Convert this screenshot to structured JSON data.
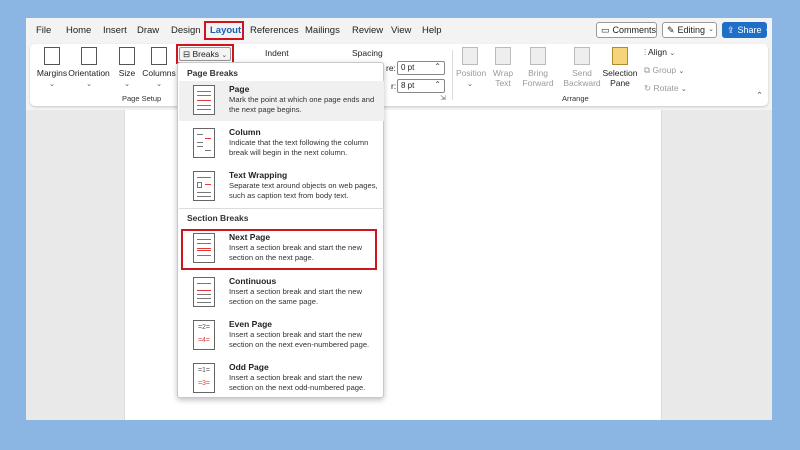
{
  "tabs": [
    "File",
    "Home",
    "Insert",
    "Draw",
    "Design",
    "Layout",
    "References",
    "Mailings",
    "Review",
    "View",
    "Help"
  ],
  "top_buttons": {
    "comments": "Comments",
    "editing": "Editing",
    "share": "Share"
  },
  "ribbon": {
    "margins": "Margins",
    "orientation": "Orientation",
    "size": "Size",
    "columns": "Columns",
    "breaks": "Breaks",
    "page_setup": "Page Setup",
    "indent": "Indent",
    "spacing": "Spacing",
    "before_label": "re:",
    "before_value": "0 pt",
    "after_label": "r:",
    "after_value": "8 pt",
    "position": "Position",
    "wrap_text_1": "Wrap",
    "wrap_text_2": "Text",
    "bring_forward_1": "Bring",
    "bring_forward_2": "Forward",
    "send_backward_1": "Send",
    "send_backward_2": "Backward",
    "selection_pane_1": "Selection",
    "selection_pane_2": "Pane",
    "align": "Align",
    "group": "Group",
    "rotate": "Rotate",
    "arrange": "Arrange"
  },
  "breaks_menu": {
    "page_breaks_header": "Page Breaks",
    "section_breaks_header": "Section Breaks",
    "items": [
      {
        "title": "Page",
        "desc": "Mark the point at which one page ends and the next page begins."
      },
      {
        "title": "Column",
        "desc": "Indicate that the text following the column break will begin in the next column."
      },
      {
        "title": "Text Wrapping",
        "desc": "Separate text around objects on web pages, such as caption text from body text."
      },
      {
        "title": "Next Page",
        "desc": "Insert a section break and start the new section on the next page."
      },
      {
        "title": "Continuous",
        "desc": "Insert a section break and start the new section on the same page."
      },
      {
        "title": "Even Page",
        "desc": "Insert a section break and start the new section on the next even-numbered page."
      },
      {
        "title": "Odd Page",
        "desc": "Insert a section break and start the new section on the next odd-numbered page."
      }
    ]
  },
  "colors": {
    "accent": "#1b5eb8",
    "highlight": "#d0141e",
    "share": "#1f6fc8"
  }
}
